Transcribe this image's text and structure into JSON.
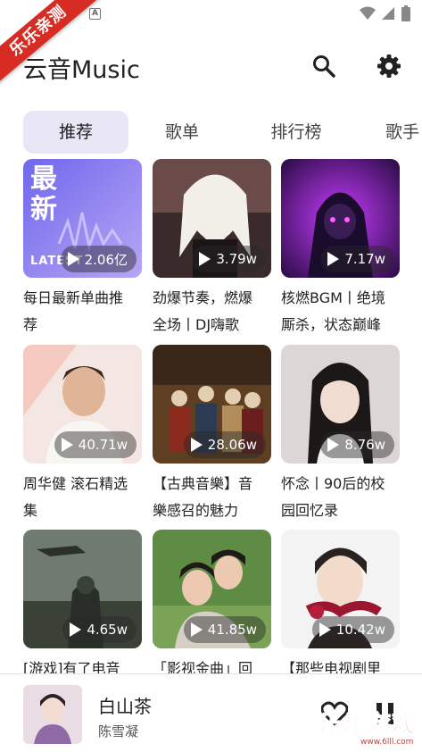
{
  "status_bar": {
    "notif_letter": "A"
  },
  "ribbon": "乐乐亲测",
  "header": {
    "title": "云音Music"
  },
  "tabs": [
    {
      "label": "推荐",
      "active": true
    },
    {
      "label": "歌单",
      "active": false
    },
    {
      "label": "排行榜",
      "active": false
    },
    {
      "label": "歌手",
      "active": false
    }
  ],
  "cards": [
    {
      "title": "每日最新单曲推\n荐",
      "plays": "2.06亿",
      "cover_text": "最\n新",
      "cover_sub": "LATEST"
    },
    {
      "title": "劲爆节奏，燃爆\n全场丨DJ嗨歌",
      "plays": "3.79w"
    },
    {
      "title": "核燃BGM丨绝境\n厮杀，状态巅峰",
      "plays": "7.17w"
    },
    {
      "title": "周华健  滚石精选\n集",
      "plays": "40.71w"
    },
    {
      "title": "【古典音樂】音\n樂感召的魅力",
      "plays": "28.06w"
    },
    {
      "title": "怀念丨90后的校\n园回忆录",
      "plays": "8.76w"
    },
    {
      "title": "[游戏]有了电音",
      "plays": "4.65w"
    },
    {
      "title": "「影视金曲」回",
      "plays": "41.85w"
    },
    {
      "title": "【那些电视剧里",
      "plays": "10.42w"
    }
  ],
  "player": {
    "song": "白山茶",
    "artist": "陈雪凝"
  },
  "watermark": {
    "text": "乐乐游戏",
    "url": "www.6lll.com"
  },
  "colors": {
    "tab_active_bg": "#e9e6f6",
    "ribbon": "#d62c24",
    "watermark": "#e23a2c"
  }
}
